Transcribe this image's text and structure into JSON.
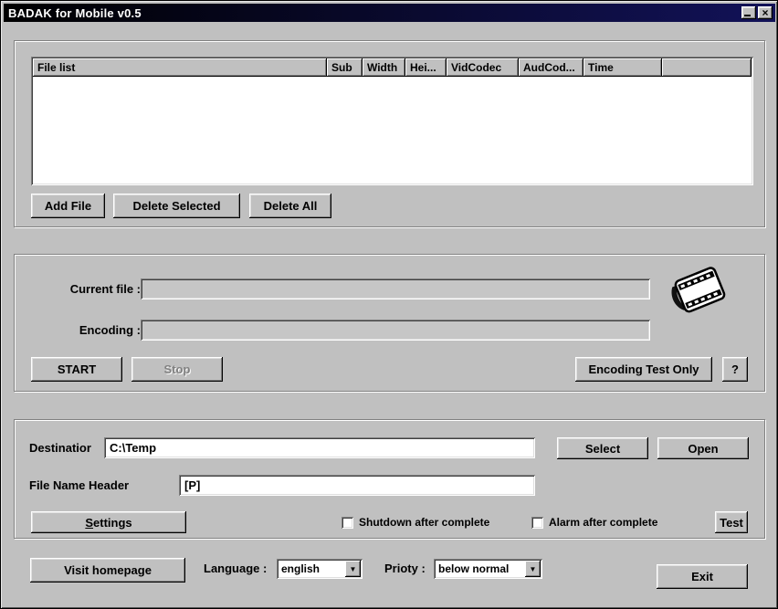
{
  "window": {
    "title": "BADAK for Mobile v0.5",
    "close_glyph": "×"
  },
  "colors": {
    "window_bg": "#c0c0c0",
    "titlebar_gradient_start": "#000000",
    "titlebar_gradient_end": "#121258",
    "titlebar_text": "#ffffff",
    "list_bg": "#ffffff",
    "disabled_text": "#808080"
  },
  "file_list": {
    "columns": [
      {
        "label": "File list"
      },
      {
        "label": "Sub"
      },
      {
        "label": "Width"
      },
      {
        "label": "Hei..."
      },
      {
        "label": "VidCodec"
      },
      {
        "label": "AudCod..."
      },
      {
        "label": "Time"
      },
      {
        "label": ""
      }
    ],
    "rows": [],
    "buttons": {
      "add_file": "Add File",
      "delete_selected": "Delete Selected",
      "delete_all": "Delete All"
    }
  },
  "encoding_section": {
    "current_file_label": "Current file :",
    "current_file_value": "",
    "encoding_label": "Encoding :",
    "encoding_value": "",
    "start_button": "START",
    "stop_button": "Stop",
    "test_only_button": "Encoding Test Only",
    "help_button": "?",
    "film_icon": "film-clip"
  },
  "output_section": {
    "destination_label": "Destinatior",
    "destination_value": "C:\\Temp",
    "file_name_header_label": "File Name Header",
    "file_name_header_value": "[P]",
    "select_button": "Select",
    "open_button": "Open",
    "settings_mnemonic": "S",
    "settings_rest": "ettings",
    "shutdown_label": "Shutdown after complete",
    "shutdown_checked": false,
    "alarm_label": "Alarm after complete",
    "alarm_checked": false,
    "test_button": "Test"
  },
  "footer": {
    "visit_homepage_button": "Visit homepage",
    "language_label": "Language :",
    "language_value": "english",
    "priority_label": "Prioty :",
    "priority_value": "below normal",
    "dropdown_arrow_glyph": "▼",
    "exit_button": "Exit"
  }
}
